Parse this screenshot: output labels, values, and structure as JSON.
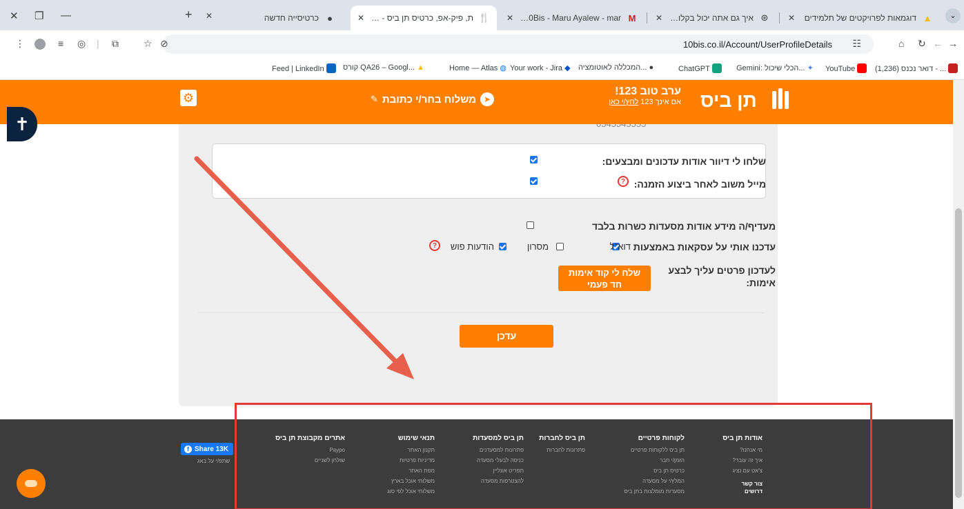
{
  "browser": {
    "tabs": [
      {
        "title": "דוגמאות לפרויקטים של תלמידים",
        "icon": "google-drive-icon"
      },
      {
        "title": "איך גם אתה יכול בקלות לכתוב כ",
        "icon": "chatgpt-icon"
      },
      {
        "title": "STR 10Bis - Maru Ayalew - mar",
        "icon": "gmail-icon"
      },
      {
        "title": "ת, פיק-אפ, כרטיס תן ביס - 10bis",
        "icon": "tenbis-icon",
        "active": true
      },
      {
        "title": "כרטיסייה חדשה",
        "icon": "chrome-icon"
      }
    ],
    "new_tab": "+",
    "url": "10bis.co.il/Account/UserProfileDetails",
    "bookmarks": [
      {
        "label": "דואר נכנס (1,236) - ...",
        "icon": "gmail-icon",
        "color": "#c5221f"
      },
      {
        "label": "YouTube",
        "icon": "youtube-icon",
        "color": "#ff0000"
      },
      {
        "label": "Gemini: הכלי שיכול...",
        "icon": "gemini-icon",
        "color": "#4285f4"
      },
      {
        "label": "ChatGPT",
        "icon": "chatgpt-icon",
        "color": "#10a37f"
      },
      {
        "label": "המכללה לאוטומציה...",
        "icon": "chrome-icon",
        "color": "#5f6368"
      },
      {
        "label": "Your work - Jira",
        "icon": "jira-icon",
        "color": "#0052cc"
      },
      {
        "label": "Home — Atlas",
        "icon": "atlas-icon",
        "color": "#1a73e8"
      },
      {
        "label": "קורס QA26 – Googl...",
        "icon": "google-drive-icon",
        "color": "#fbbc04"
      },
      {
        "label": "Feed | LinkedIn",
        "icon": "linkedin-icon",
        "color": "#0a66c2"
      }
    ]
  },
  "header": {
    "logo": "תן ביס",
    "greeting": "ערב טוב 123!",
    "not_you": "אם אינך 123",
    "click_here": "לחץ/י כאן",
    "deliver_to": "משלוח בחר/י כתובת",
    "brand_color": "#ff8000"
  },
  "form": {
    "phone_cut": "0545545555",
    "newsletter_label": "שלחו לי דיוור אודות עדכונים ומבצעים:",
    "newsletter_checked": true,
    "feedback_label": "מייל משוב לאחר ביצוע הזמנה:",
    "feedback_checked": true,
    "kosher_label": "מעדיף/ה מידע אודות מסעדות כשרות בלבד",
    "kosher_checked": false,
    "deals_label": "עדכנו אותי על עסקאות באמצעות",
    "deal_options": [
      {
        "label": "דוא\"ל",
        "checked": true
      },
      {
        "label": "מסרון",
        "checked": false
      },
      {
        "label": "הודעות פוש",
        "checked": true
      }
    ],
    "verify_label_1": "לעדכון פרטים עליך לבצע",
    "verify_label_2": "אימות:",
    "send_code_1": "שלח לי קוד אימות",
    "send_code_2": "חד פעמי",
    "update_button": "עדכן",
    "help_glyph": "?"
  },
  "footer": {
    "columns": [
      {
        "heading": "אודות תן ביס",
        "items": [
          "מי אנחנו?",
          "איך זה עובד?",
          "צ'אט עם נציג",
          "צור קשר"
        ],
        "bold_item": "דרושים"
      },
      {
        "heading": "לקוחות פרטיים",
        "items": [
          "תן ביס ללקוחות פרטיים",
          "הזמן/י חבר",
          "כרטיס תן ביס",
          "המלץ/י על מסעדה",
          "מסעדות מומלצות בתן ביס"
        ]
      },
      {
        "heading": "תן ביס לחברות",
        "items": [
          "פתרונות לחברות"
        ]
      },
      {
        "heading": "תן ביס למסעדות",
        "items": [
          "פתרונות למסעדנים",
          "כניסה לבעלי מסעדה",
          "תפריט אונליין",
          "להצטרפות מסעדה"
        ]
      },
      {
        "heading": "תנאי שימוש",
        "items": [
          "תקנון האתר",
          "מדיניות פרטיות",
          "מפת האתר",
          "משלוחי אוכל בארץ",
          "משלוחי אוכל לפי סוג"
        ]
      },
      {
        "heading": "אתרים מקבוצת תן ביס",
        "items": [
          "Paypo",
          "שולחן לשניים"
        ]
      }
    ],
    "share_label": "Share 13K",
    "share_sub": "שתפ/י על באג"
  },
  "annotation": {
    "color": "#e53935"
  }
}
